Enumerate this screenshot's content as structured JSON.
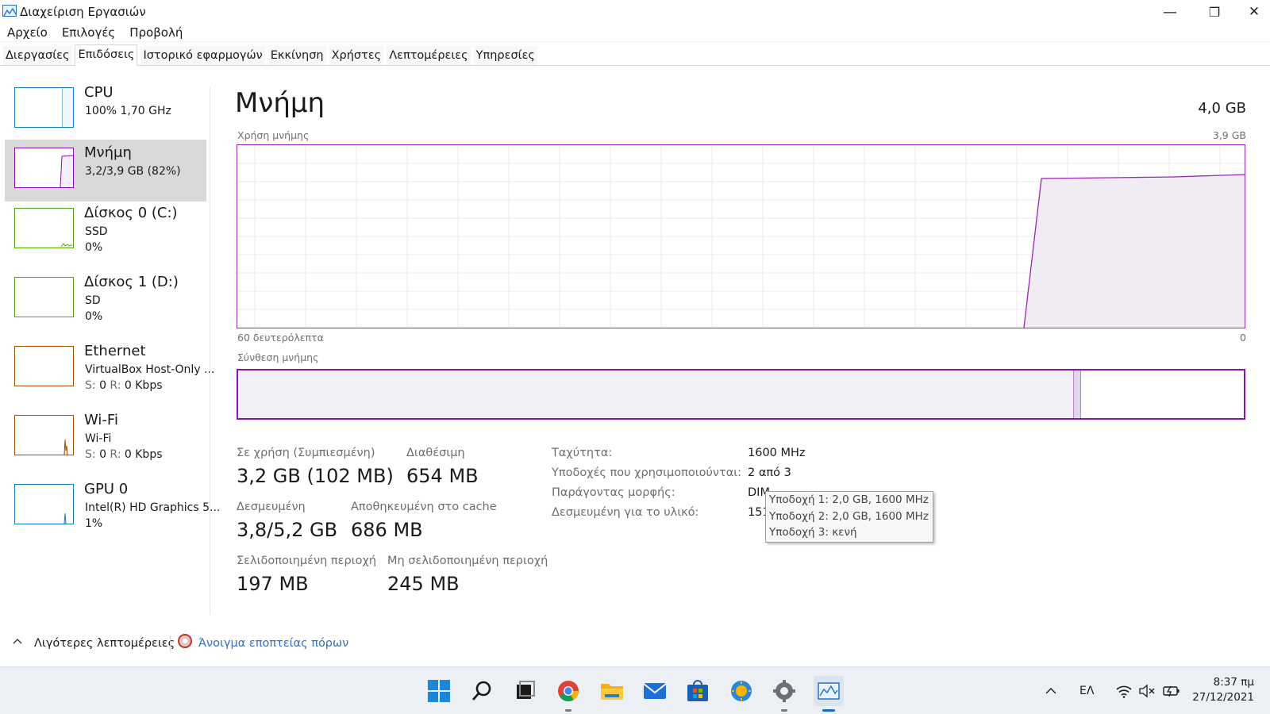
{
  "window": {
    "title": "Διαχείριση Εργασιών",
    "minimize_glyph": "—",
    "restore_glyph": "❐",
    "close_glyph": "✕"
  },
  "menu": [
    "Αρχείο",
    "Επιλογές",
    "Προβολή"
  ],
  "tabs": [
    {
      "label": "Διεργασίες",
      "active": false
    },
    {
      "label": "Επιδόσεις",
      "active": true
    },
    {
      "label": "Ιστορικό εφαρμογών",
      "active": false
    },
    {
      "label": "Εκκίνηση",
      "active": false
    },
    {
      "label": "Χρήστες",
      "active": false
    },
    {
      "label": "Λεπτομέρειες",
      "active": false
    },
    {
      "label": "Υπηρεσίες",
      "active": false
    }
  ],
  "sidebar": {
    "items": [
      {
        "title": "CPU",
        "line1": "100%  1,70 GHz",
        "line2": "",
        "color": "#117dbb",
        "selected": false
      },
      {
        "title": "Μνήμη",
        "line1": "3,2/3,9 GB (82%)",
        "line2": "",
        "color": "#8b12ae",
        "selected": true
      },
      {
        "title": "Δίσκος 0 (C:)",
        "line1": "SSD",
        "line2": "0%",
        "color": "#4da60c",
        "selected": false
      },
      {
        "title": "Δίσκος 1 (D:)",
        "line1": "SD",
        "line2": "0%",
        "color": "#4da60c",
        "selected": false
      },
      {
        "title": "Ethernet",
        "line1": "VirtualBox Host-Only ...",
        "line2a": "S: ",
        "line2b": "0 ",
        "line2c": "R: ",
        "line2d": "0 Kbps",
        "color": "#a74f01",
        "selected": false
      },
      {
        "title": "Wi-Fi",
        "line1": "Wi-Fi",
        "line2a": "S: ",
        "line2b": "0 ",
        "line2c": "R: ",
        "line2d": "0 Kbps",
        "color": "#a74f01",
        "selected": false
      },
      {
        "title": "GPU 0",
        "line1": "Intel(R) HD Graphics 5...",
        "line2": "1%",
        "color": "#117dbb",
        "selected": false
      }
    ]
  },
  "main": {
    "title": "Μνήμη",
    "total": "4,0 GB",
    "usage_label": "Χρήση μνήμης",
    "usage_max": "3,9 GB",
    "time_left": "60 δευτερόλεπτα",
    "time_right": "0",
    "composition_label": "Σύνθεση μνήμης",
    "accent_color": "#8b12ae",
    "stats": {
      "in_use_label": "Σε χρήση (Συμπιεσμένη)",
      "in_use_value": "3,2 GB (102 MB)",
      "available_label": "Διαθέσιμη",
      "available_value": "654 MB",
      "committed_label": "Δεσμευμένη",
      "committed_value": "3,8/5,2 GB",
      "cached_label": "Αποθηκευμένη στο cache",
      "cached_value": "686 MB",
      "paged_label": "Σελιδοποιημένη περιοχή",
      "paged_value": "197 MB",
      "nonpaged_label": "Μη σελιδοποιημένη περιοχή",
      "nonpaged_value": "245 MB"
    },
    "details": {
      "speed_label": "Ταχύτητα:",
      "speed_value": "1600 MHz",
      "slots_label": "Υποδοχές που χρησιμοποιούνται:",
      "slots_value": "2 από 3",
      "form_label": "Παράγοντας μορφής:",
      "form_value": "DIM",
      "reserved_label": "Δεσμευμένη για το υλικό:",
      "reserved_value": "151"
    },
    "tooltip": [
      "Υποδοχή 1: 2,0 GB, 1600 MHz",
      "Υποδοχή 2: 2,0 GB, 1600 MHz",
      "Υποδοχή 3: κενή"
    ]
  },
  "footer": {
    "fewer_details": "Λιγότερες λεπτομέρειες",
    "resource_monitor": "Άνοιγμα εποπτείας πόρων"
  },
  "taskbar": {
    "icons": [
      "windows-start-icon",
      "search-icon",
      "task-view-icon",
      "chrome-icon",
      "file-explorer-icon",
      "mail-icon",
      "microsoft-store-icon",
      "weather-icon",
      "settings-icon",
      "task-manager-icon"
    ],
    "tray_language": "ΕΛ",
    "clock_time": "8:37 πμ",
    "clock_date": "27/12/2021"
  }
}
